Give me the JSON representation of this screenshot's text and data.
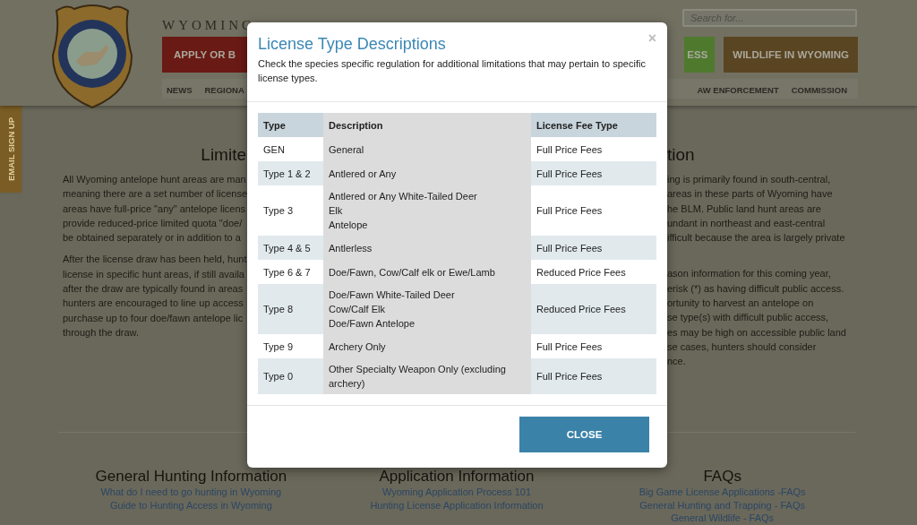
{
  "header": {
    "title": "WYOMING",
    "search": {
      "placeholder": "Search for..."
    },
    "nav_left": [
      {
        "label": "APPLY OR B",
        "color": "#6a1a14"
      }
    ],
    "nav_right": [
      {
        "label": "ESS",
        "color": "#4f7a2e"
      },
      {
        "label": "WILDLIFE IN WYOMING",
        "color": "#5a4522"
      }
    ],
    "subnav_left": [
      "NEWS",
      "REGIONA"
    ],
    "subnav_right": [
      "AW ENFORCEMENT",
      "COMMISSION"
    ]
  },
  "email_tab": "EMAIL SIGN UP",
  "left_section": {
    "heading": "Limite",
    "paragraphs": [
      [
        "All Wyoming antelope hunt areas are man",
        "meaning there are a set number of license",
        "areas have full-price \"any\" antelope licens",
        "provide reduced-price limited quota \"doe/",
        "be obtained separately or in addition to a"
      ],
      [
        "After the license draw has been held, hunt",
        "license in specific hunt areas, if still availa",
        "after the draw are typically found in areas",
        "hunters are encouraged to line up access",
        "purchase up to four doe/fawn antelope lic",
        "through the draw."
      ]
    ]
  },
  "right_section": {
    "heading": "tion",
    "paragraphs": [
      [
        "ing is primarily found in south-central,",
        "areas in these parts of Wyoming have",
        "he BLM. Public land hunt areas are",
        "undant in northeast and east-central",
        "ifficult because the area is largely private"
      ],
      [
        "ason information for this coming year,",
        "erisk (*) as having difficult public access.",
        "ortunity to harvest an antelope on",
        "se type(s) with difficult public access,",
        "es may be high on accessible public land",
        "se cases, hunters should consider",
        "nce."
      ]
    ]
  },
  "footer": [
    {
      "heading": "General Hunting Information",
      "links": [
        "What do I need to go hunting in Wyoming",
        "Guide to Hunting Access in Wyoming"
      ]
    },
    {
      "heading": "Application Information",
      "links": [
        "Wyoming Application Process 101",
        "Hunting License Application Information"
      ]
    },
    {
      "heading": "FAQs",
      "links": [
        "Big Game License Applications -FAQs",
        "General Hunting and Trapping - FAQs",
        "General Wildlife - FAQs"
      ]
    }
  ],
  "modal": {
    "title": "License Type Descriptions",
    "close": "×",
    "subtitle": "Check the species specific regulation for additional limitations that may pertain to specific license types.",
    "table": {
      "columns": [
        "Type",
        "Description",
        "License Fee Type"
      ],
      "rows": [
        {
          "type": "GEN",
          "description": [
            "General"
          ],
          "fee": "Full Price Fees"
        },
        {
          "type": "Type 1 & 2",
          "description": [
            "Antlered or Any"
          ],
          "fee": "Full Price Fees"
        },
        {
          "type": "Type 3",
          "description": [
            "Antlered or Any White-Tailed Deer",
            "Elk",
            "Antelope"
          ],
          "fee": "Full Price Fees"
        },
        {
          "type": "Type 4 & 5",
          "description": [
            "Antlerless"
          ],
          "fee": "Full Price Fees"
        },
        {
          "type": "Type 6 & 7",
          "description": [
            "Doe/Fawn, Cow/Calf elk or Ewe/Lamb"
          ],
          "fee": "Reduced Price Fees"
        },
        {
          "type": "Type 8",
          "description": [
            "Doe/Fawn White-Tailed Deer",
            "Cow/Calf Elk",
            "Doe/Fawn Antelope"
          ],
          "fee": "Reduced Price Fees"
        },
        {
          "type": "Type 9",
          "description": [
            "Archery Only"
          ],
          "fee": "Full Price Fees"
        },
        {
          "type": "Type 0",
          "description": [
            "Other Specialty Weapon Only (excluding archery)"
          ],
          "fee": "Full Price Fees"
        }
      ]
    },
    "button": "CLOSE"
  }
}
